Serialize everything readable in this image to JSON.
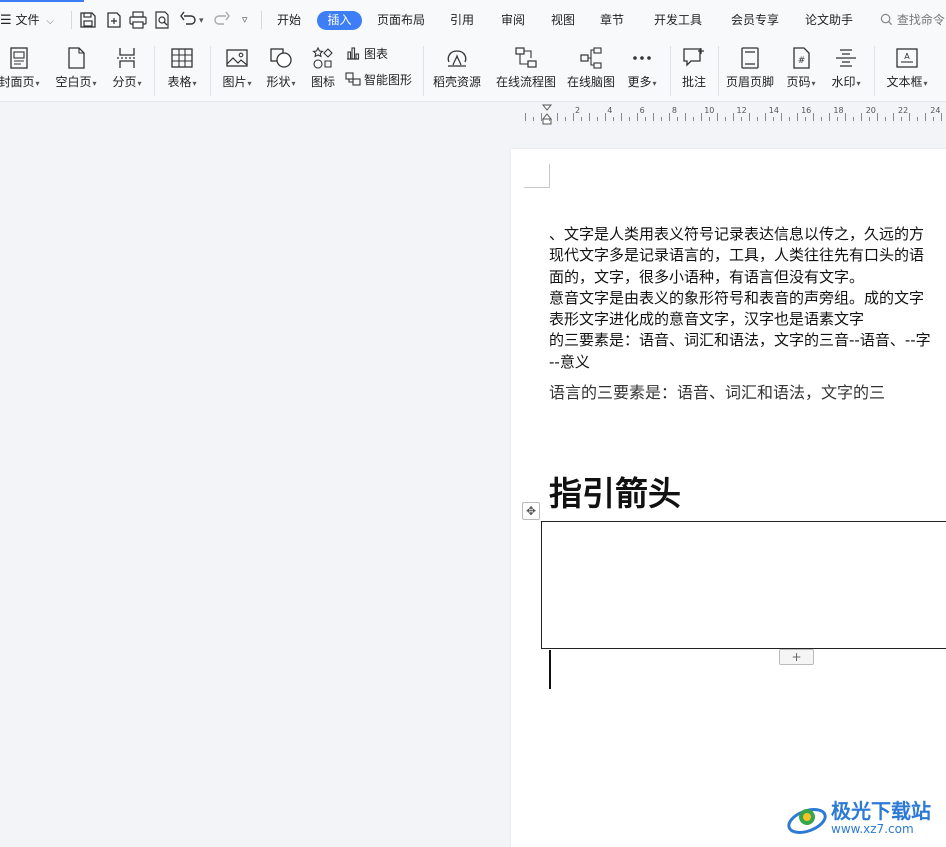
{
  "menubar": {
    "file_label": "文件",
    "tabs": [
      "开始",
      "插入",
      "页面布局",
      "引用",
      "审阅",
      "视图",
      "章节",
      "开发工具",
      "会员专享",
      "论文助手"
    ],
    "active_tab": "插入",
    "search_placeholder": "查找命令"
  },
  "ribbon": {
    "buttons": [
      {
        "label": "封面页",
        "icon": "cover-page-icon",
        "dropdown": true
      },
      {
        "label": "空白页",
        "icon": "blank-page-icon",
        "dropdown": true
      },
      {
        "label": "分页",
        "icon": "page-break-icon",
        "dropdown": true
      },
      {
        "label": "表格",
        "icon": "table-icon",
        "dropdown": true
      },
      {
        "label": "图片",
        "icon": "picture-icon",
        "dropdown": true
      },
      {
        "label": "形状",
        "icon": "shape-icon",
        "dropdown": true
      },
      {
        "label": "图标",
        "icon": "icons-icon",
        "dropdown": false
      },
      {
        "label": "稻壳资源",
        "icon": "docer-resource-icon",
        "dropdown": false
      },
      {
        "label": "在线流程图",
        "icon": "flowchart-icon",
        "dropdown": false
      },
      {
        "label": "在线脑图",
        "icon": "mindmap-icon",
        "dropdown": false
      },
      {
        "label": "更多",
        "icon": "more-icon",
        "dropdown": true
      },
      {
        "label": "批注",
        "icon": "comment-icon",
        "dropdown": false
      },
      {
        "label": "页眉页脚",
        "icon": "header-footer-icon",
        "dropdown": false
      },
      {
        "label": "页码",
        "icon": "page-number-icon",
        "dropdown": true
      },
      {
        "label": "水印",
        "icon": "watermark-icon",
        "dropdown": true
      },
      {
        "label": "文本框",
        "icon": "textbox-icon",
        "dropdown": true
      }
    ],
    "small_buttons": [
      {
        "label": "图表",
        "icon": "chart-icon"
      },
      {
        "label": "智能图形",
        "icon": "smart-art-icon"
      }
    ]
  },
  "ruler": {
    "numbers": [
      "2",
      "4",
      "6",
      "8",
      "10",
      "12",
      "14",
      "16",
      "18",
      "20",
      "22",
      "24"
    ]
  },
  "document": {
    "lines": [
      "、文字是人类用表义符号记录表达信息以传之，久远的方",
      "现代文字多是记录语言的，工具，人类往往先有口头的语",
      "面的，文字，很多小语种，有语言但没有文字。",
      "意音文字是由表义的象形符号和表音的声旁组。成的文字",
      "表形文字进化成的意音文字，汉字也是语素文字",
      "的三要素是：语音、词汇和语法，文字的三音--语音、--字",
      "--意义"
    ],
    "serif_line": "语言的三要素是：语音、词汇和语法，文字的三",
    "heading": "指引箭头",
    "table_move_glyph": "✥",
    "add_row_glyph": "+"
  },
  "watermark": {
    "title": "极光下载站",
    "url": "www.xz7.com"
  },
  "colors": {
    "accent": "#3d7ef7",
    "watermark": "#2d7ad6"
  }
}
